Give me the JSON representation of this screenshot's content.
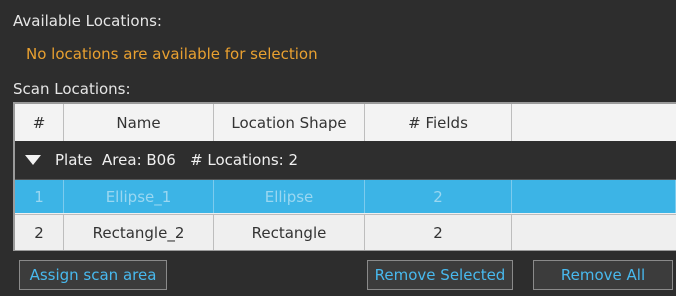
{
  "available": {
    "label": "Available Locations:",
    "empty_message": "No locations are available for selection"
  },
  "scan": {
    "label": "Scan Locations:",
    "columns": [
      "#",
      "Name",
      "Location Shape",
      "# Fields",
      ""
    ],
    "group": {
      "text": "Plate  Area: B06   # Locations: 2"
    },
    "rows": [
      {
        "num": "1",
        "name": "Ellipse_1",
        "shape": "Ellipse",
        "fields": "2",
        "selected": true
      },
      {
        "num": "2",
        "name": "Rectangle_2",
        "shape": "Rectangle",
        "fields": "2",
        "selected": false
      }
    ]
  },
  "buttons": {
    "assign": "Assign scan area",
    "remove_selected": "Remove Selected",
    "remove_all": "Remove All"
  },
  "colors": {
    "warning_text": "#e9a030",
    "selection": "#3cb4e6",
    "link_text": "#48b9ee"
  }
}
